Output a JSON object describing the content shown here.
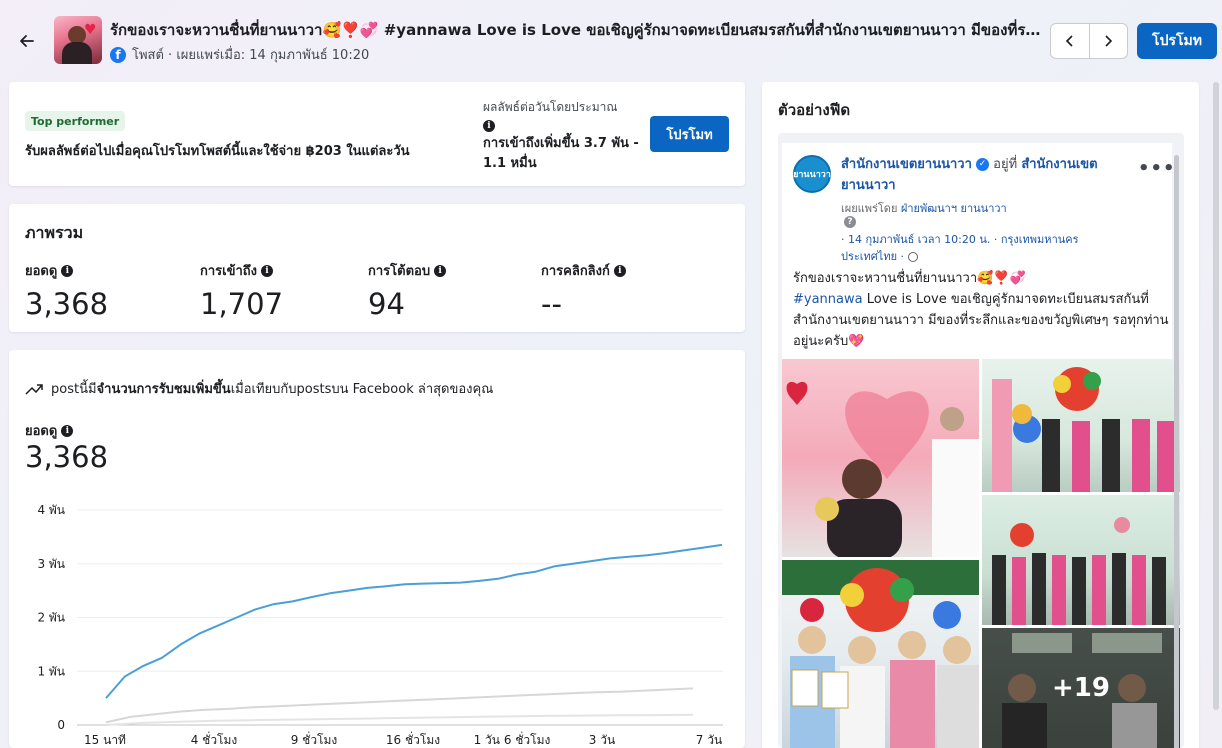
{
  "header": {
    "title": "รักของเราจะหวานชื่นที่ยานนาวา🥰❣️💞 #yannawa Love is Love ขอเชิญคู่รักมาจดทะเบียนสมรสกันที่สำนักงานเขตยานนาวา มีของที่ระลึกและของขวัญพิเศษๆ รอทุกท่านอยู่นะครับ💖",
    "subtitle": "โพสต์ · เผยแพร่เมื่อ: 14 กุมภาพันธ์ 10:20",
    "promote_label": "โปรโมท"
  },
  "promo_card": {
    "badge": "Top performer",
    "text": "รับผลลัพธ์ต่อไปเมื่อคุณโปรโมทโพสต์นี้และใช้จ่าย ฿203 ในแต่ละวัน",
    "estimate_label": "ผลลัพธ์ต่อวันโดยประมาณ",
    "estimate_value": "การเข้าถึงเพิ่มขึ้น 3.7 พัน - 1.1 หมื่น",
    "button": "โปรโมท"
  },
  "overview": {
    "title": "ภาพรวม",
    "metrics": [
      {
        "label": "ยอดดู",
        "value": "3,368"
      },
      {
        "label": "การเข้าถึง",
        "value": "1,707"
      },
      {
        "label": "การโต้ตอบ",
        "value": "94"
      },
      {
        "label": "การคลิกลิงก์",
        "value": "--"
      }
    ]
  },
  "chart_card": {
    "trend_prefix": "postนี้มี",
    "trend_bold": "จำนวนการรับชมเพิ่มขึ้น",
    "trend_suffix": "เมื่อเทียบกับpostsบน Facebook ล่าสุดของคุณ",
    "metric_label": "ยอดดู",
    "metric_value": "3,368"
  },
  "chart_data": {
    "type": "line",
    "x": [
      "15 นาที",
      "4 ชั่วโมง",
      "9 ชั่วโมง",
      "16 ชั่วโมง",
      "1 วัน 6 ชั่วโมง",
      "3 วัน",
      "7 วัน"
    ],
    "y_ticks": [
      "0",
      "1 พัน",
      "2 พัน",
      "3 พัน",
      "4 พัน"
    ],
    "ylim": [
      0,
      4000
    ],
    "series": [
      {
        "color": "#4a9fd8",
        "values": [
          500,
          900,
          1100,
          1250,
          1500,
          1700,
          1850,
          2000,
          2150,
          2250,
          2300,
          2380,
          2450,
          2500,
          2550,
          2580,
          2620,
          2630,
          2640,
          2650,
          2680,
          2720,
          2800,
          2850,
          2950,
          3000,
          3050,
          3100,
          3130,
          3160,
          3200,
          3250,
          3300,
          3350
        ]
      },
      {
        "color": "#d5d7da",
        "values": [
          50,
          150,
          200,
          250,
          280,
          300,
          330,
          350,
          370,
          390,
          410,
          430,
          450,
          470,
          490,
          510,
          530,
          550,
          570,
          590,
          610,
          620,
          640,
          660,
          680
        ]
      },
      {
        "color": "#e3e4e6",
        "values": [
          0,
          40,
          60,
          80,
          90,
          100,
          110,
          120,
          130,
          140,
          150,
          160,
          170,
          175,
          180,
          185,
          190
        ]
      }
    ]
  },
  "preview": {
    "title": "ตัวอย่างฟีด",
    "page_name": "สำนักงานเขตยานนาวา",
    "at_text": "อยู่ที่",
    "location_name": "สำนักงานเขตยานนาวา",
    "avatar_text": "ยานนาวา",
    "published_by_prefix": "เผยแพร่โดย",
    "published_by": "ฝ่ายพัฒนาฯ ยานนาวา",
    "date_line": "· 14 กุมภาพันธ์ เวลา 10:20 น. · กรุงเทพมหานคร ประเทศไทย ·",
    "post_line1": "รักของเราจะหวานชื่นที่ยานนาวา🥰❣️💞",
    "post_hashtag": "#yannawa",
    "post_line2": "Love is Love  ขอเชิญคู่รักมาจดทะเบียนสมรสกันที่สำนักงานเขตยานนาวา มีของที่ระลึกและของขวัญพิเศษๆ รอทุกท่านอยู่นะครับ💖",
    "more_photos": "+19"
  }
}
